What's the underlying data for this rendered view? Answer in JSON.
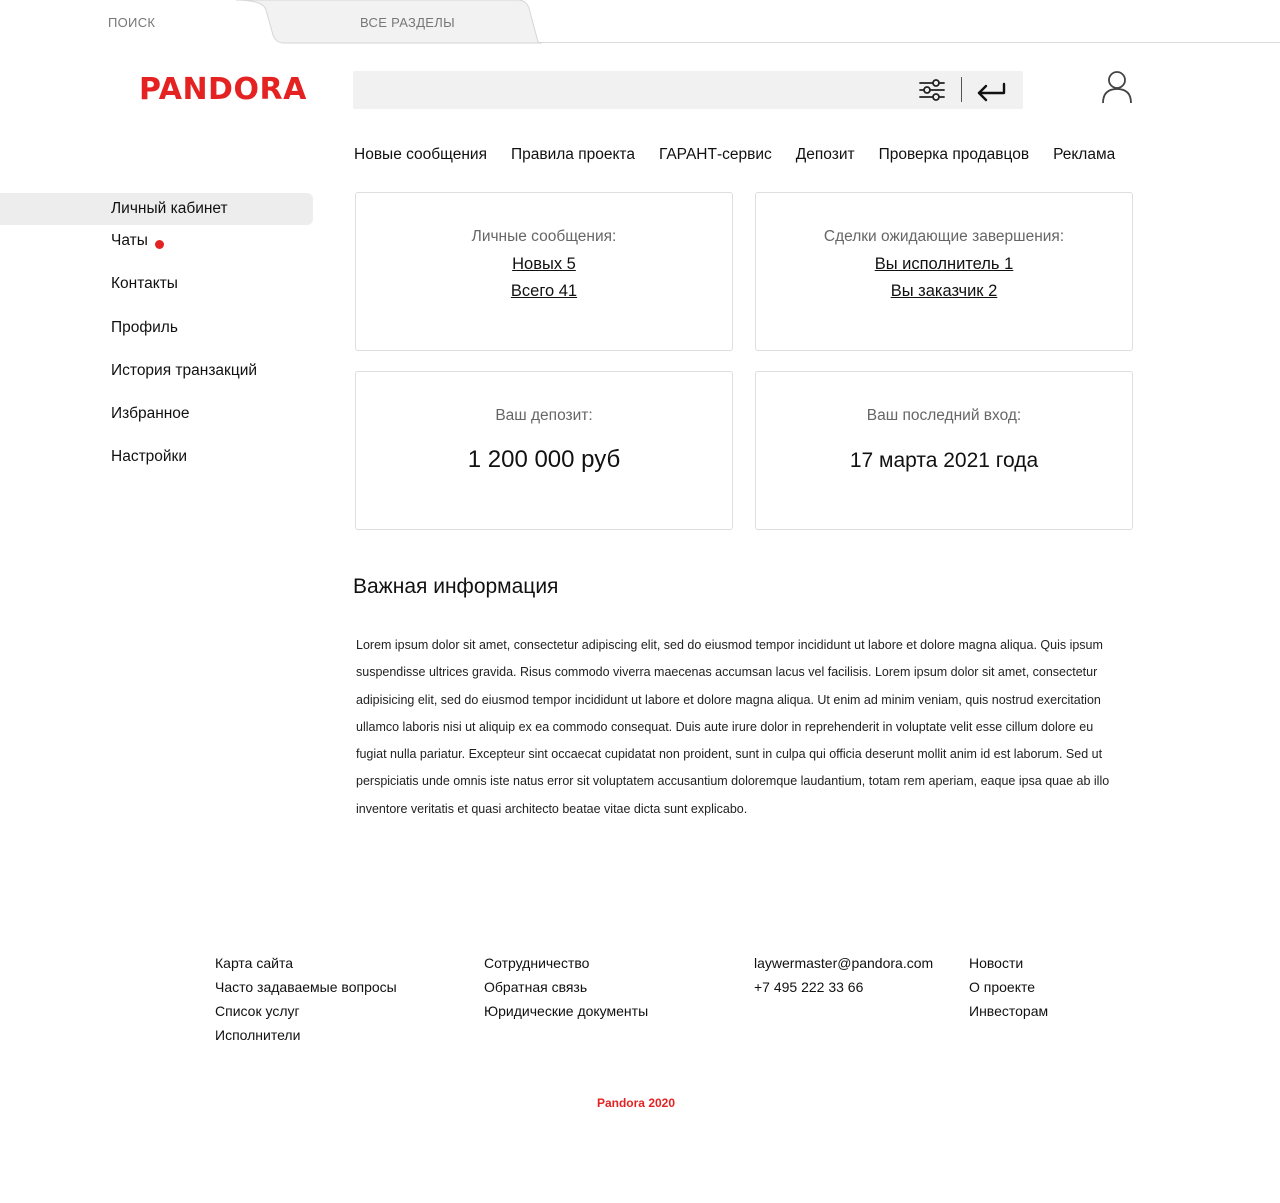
{
  "tabs": {
    "search": "ПОИСК",
    "all_sections": "ВСЕ РАЗДЕЛЫ"
  },
  "header": {
    "logo": "PANDORA",
    "search_placeholder": "",
    "icons": [
      "filter-sliders-icon",
      "enter-arrow-icon",
      "user-icon"
    ]
  },
  "nav": [
    "Новые сообщения",
    "Правила проекта",
    "ГАРАНТ-сервис",
    "Депозит",
    "Проверка продавцов",
    "Реклама"
  ],
  "sidebar": {
    "items": [
      "Личный кабинет",
      "Чаты",
      "Контакты",
      "Профиль",
      "История транзакций",
      "Избранное",
      "Настройки"
    ],
    "active": "Личный кабинет",
    "notification_dot_on": "Чаты"
  },
  "cards": {
    "messages": {
      "title": "Личные сообщения:",
      "new": "Новых 5",
      "total": "Всего 41"
    },
    "deals": {
      "title": "Сделки ожидающие завершения:",
      "executor": "Вы исполнитель 1",
      "customer": "Вы заказчик 2"
    },
    "deposit": {
      "title": "Ваш депозит:",
      "value": "1 200 000 руб"
    },
    "last_login": {
      "title": "Ваш последний вход:",
      "value": "17 марта 2021 года"
    }
  },
  "info": {
    "title": "Важная информация",
    "text": "Lorem ipsum dolor sit amet, consectetur adipiscing elit, sed do eiusmod tempor incididunt ut labore et dolore magna aliqua. Quis ipsum suspendisse ultrices gravida. Risus commodo viverra maecenas accumsan lacus vel facilisis. Lorem ipsum dolor sit amet, consectetur adipisicing elit, sed do eiusmod tempor incididunt ut labore et dolore magna aliqua. Ut enim ad minim veniam, quis nostrud exercitation ullamco laboris nisi ut aliquip ex ea commodo consequat. Duis aute irure dolor in reprehenderit in voluptate velit esse cillum dolore eu fugiat nulla pariatur. Excepteur sint occaecat cupidatat non proident, sunt in culpa qui officia deserunt mollit anim id est laborum. Sed ut perspiciatis unde omnis iste natus error sit voluptatem accusantium doloremque laudantium, totam rem aperiam, eaque ipsa quae ab illo inventore veritatis et quasi architecto beatae vitae dicta sunt explicabo."
  },
  "footer": {
    "col1": [
      "Карта сайта",
      "Часто задаваемые вопросы",
      "Список услуг",
      "Исполнители"
    ],
    "col2": [
      "Сотрудничество",
      "Обратная связь",
      "Юридические документы"
    ],
    "col3": [
      "laywermaster@pandora.com",
      "+7 495 222 33 66"
    ],
    "col4": [
      "Новости",
      "О проекте",
      "Инвесторам"
    ],
    "copyright": "Pandora 2020"
  },
  "colors": {
    "brand": "#e52222",
    "search_bg": "#f1f1f1",
    "active_sidebar_bg": "#ededed",
    "card_border": "#dedede"
  }
}
